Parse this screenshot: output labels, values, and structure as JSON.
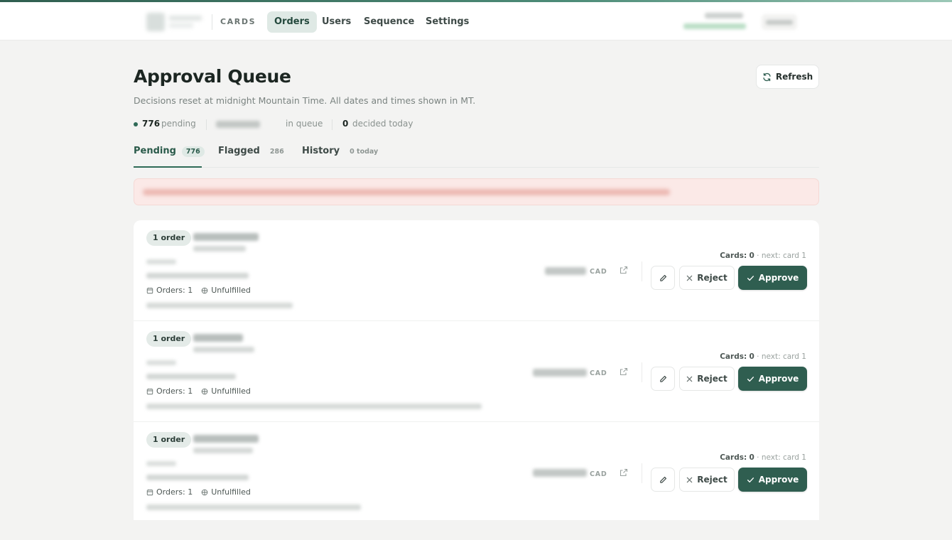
{
  "nav": {
    "brand": "CARDS",
    "items": [
      {
        "label": "Orders",
        "active": true
      },
      {
        "label": "Users",
        "active": false
      },
      {
        "label": "Sequence",
        "active": false
      },
      {
        "label": "Settings",
        "active": false
      }
    ]
  },
  "page": {
    "title": "Approval Queue",
    "subtitle": "Decisions reset at midnight Mountain Time. All dates and times shown in MT.",
    "refresh_label": "Refresh"
  },
  "stats": {
    "pending_count": "776",
    "pending_label": "pending",
    "queue_label": "in queue",
    "decided_count": "0",
    "decided_label": "decided today"
  },
  "tabs": [
    {
      "label": "Pending",
      "badge": "776",
      "active": true
    },
    {
      "label": "Flagged",
      "badge": "286",
      "active": false
    },
    {
      "label": "History",
      "badge": "0 today",
      "active": false
    }
  ],
  "orders": [
    {
      "badge": "1 order",
      "orders_label": "Orders: 1",
      "status": "Unfulfilled",
      "currency": "CAD",
      "cards_label": "Cards:",
      "cards_count": "0",
      "cards_next": "· next: card 1",
      "reject_label": "Reject",
      "approve_label": "Approve"
    },
    {
      "badge": "1 order",
      "orders_label": "Orders: 1",
      "status": "Unfulfilled",
      "currency": "CAD",
      "cards_label": "Cards:",
      "cards_count": "0",
      "cards_next": "· next: card 1",
      "reject_label": "Reject",
      "approve_label": "Approve"
    },
    {
      "badge": "1 order",
      "orders_label": "Orders: 1",
      "status": "Unfulfilled",
      "currency": "CAD",
      "cards_label": "Cards:",
      "cards_count": "0",
      "cards_next": "· next: card 1",
      "reject_label": "Reject",
      "approve_label": "Approve"
    }
  ],
  "colors": {
    "accent": "#2f5e50",
    "accent_light": "#dfe9e5",
    "alert_bg": "#fbe9e7",
    "page_bg": "#f3f3f2"
  },
  "icons": {
    "refresh": "refresh-icon",
    "calendar": "calendar-icon",
    "package": "package-icon",
    "external": "external-link-icon",
    "edit": "pencil-icon",
    "reject": "close-icon",
    "approve": "check-icon"
  }
}
